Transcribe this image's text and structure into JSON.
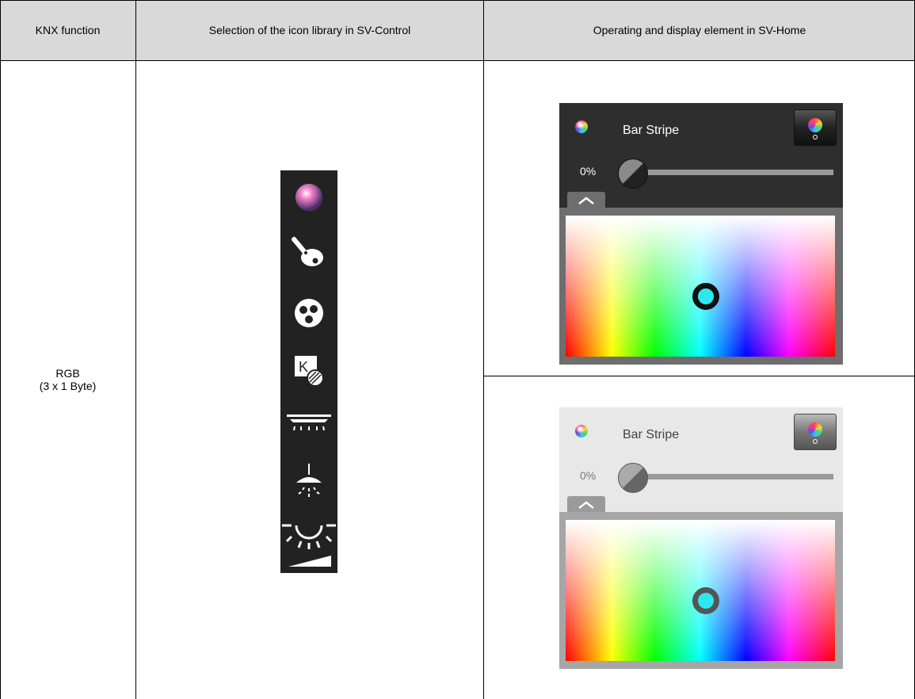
{
  "headers": {
    "col1": "KNX function",
    "col2": "Selection of the icon library in SV-Control",
    "col3": "Operating and display element in SV-Home"
  },
  "knx_function": {
    "line1": "RGB",
    "line2": "(3 x 1 Byte)"
  },
  "icon_library": {
    "icons": [
      "color-wheel-icon",
      "paint-brush-palette-icon",
      "color-dots-icon",
      "kelvin-contrast-icon",
      "ceiling-light-icon",
      "pendant-lamp-icon",
      "dimmer-light-icon"
    ],
    "kelvin_letter": "K"
  },
  "widget_dark": {
    "theme": "dark",
    "title": "Bar Stripe",
    "percent": "0%",
    "level": 0
  },
  "widget_light": {
    "theme": "light",
    "title": "Bar Stripe",
    "percent": "0%",
    "level": 0
  },
  "colors": {
    "header_bg": "#d9d9d9",
    "strip_bg": "#222222",
    "dark_panel": "#2e2e2e",
    "light_panel": "#e8e8e8",
    "picker": "#2ee8f0"
  }
}
